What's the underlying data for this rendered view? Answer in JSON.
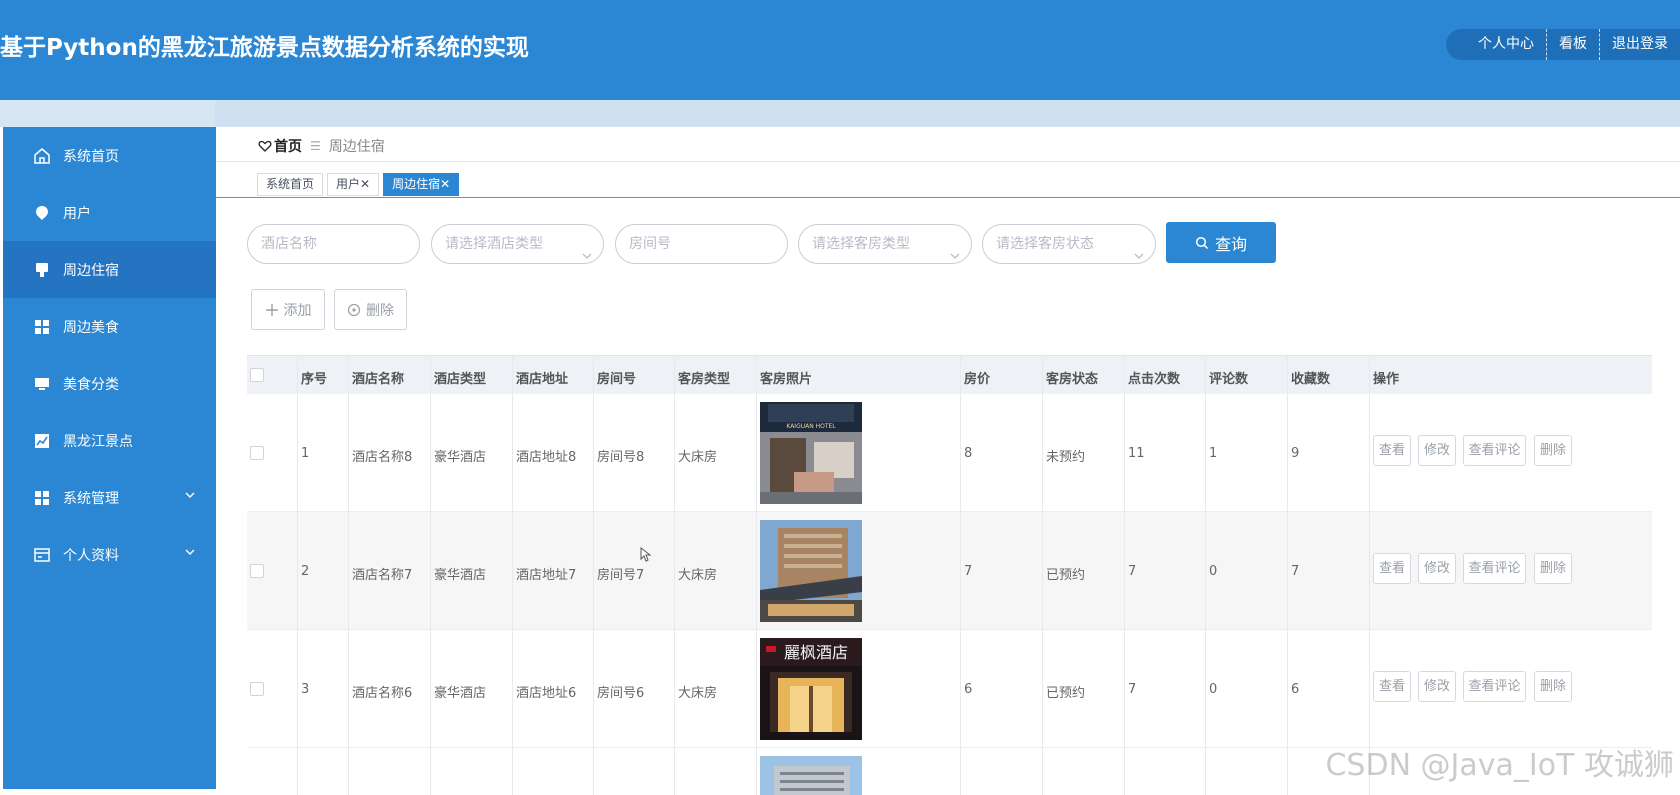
{
  "header": {
    "title": "基于Python的黑龙江旅游景点数据分析系统的实现",
    "actions": [
      "个人中心",
      "看板",
      "退出登录"
    ]
  },
  "sidebar": {
    "items": [
      {
        "label": "系统首页",
        "icon": "home-icon"
      },
      {
        "label": "用户",
        "icon": "user-icon"
      },
      {
        "label": "周边住宿",
        "icon": "hotel-icon",
        "active": true
      },
      {
        "label": "周边美食",
        "icon": "grid-icon"
      },
      {
        "label": "美食分类",
        "icon": "monitor-icon"
      },
      {
        "label": "黑龙江景点",
        "icon": "chart-icon"
      },
      {
        "label": "系统管理",
        "icon": "grid-icon",
        "expandable": true
      },
      {
        "label": "个人资料",
        "icon": "profile-icon",
        "expandable": true
      }
    ]
  },
  "breadcrumb": {
    "home": "首页",
    "current": "周边住宿"
  },
  "tabs": [
    {
      "label": "系统首页",
      "closable": false
    },
    {
      "label": "用户",
      "closable": true
    },
    {
      "label": "周边住宿",
      "closable": true,
      "active": true
    }
  ],
  "search": {
    "hotel_name_placeholder": "酒店名称",
    "hotel_type_placeholder": "请选择酒店类型",
    "room_no_placeholder": "房间号",
    "room_type_placeholder": "请选择客房类型",
    "room_status_placeholder": "请选择客房状态",
    "query_label": "查询"
  },
  "actions": {
    "add_label": "添加",
    "delete_label": "删除"
  },
  "table": {
    "headers": [
      "序号",
      "酒店名称",
      "酒店类型",
      "酒店地址",
      "房间号",
      "客房类型",
      "客房照片",
      "房价",
      "客房状态",
      "点击次数",
      "评论数",
      "收藏数",
      "操作"
    ],
    "rows": [
      {
        "index": "1",
        "name": "酒店名称8",
        "type": "豪华酒店",
        "address": "酒店地址8",
        "room_no": "房间号8",
        "room_type": "大床房",
        "price": "8",
        "status": "未预约",
        "clicks": "11",
        "comments": "1",
        "favorites": "9"
      },
      {
        "index": "2",
        "name": "酒店名称7",
        "type": "豪华酒店",
        "address": "酒店地址7",
        "room_no": "房间号7",
        "room_type": "大床房",
        "price": "7",
        "status": "已预约",
        "clicks": "7",
        "comments": "0",
        "favorites": "7"
      },
      {
        "index": "3",
        "name": "酒店名称6",
        "type": "豪华酒店",
        "address": "酒店地址6",
        "room_no": "房间号6",
        "room_type": "大床房",
        "price": "6",
        "status": "已预约",
        "clicks": "7",
        "comments": "0",
        "favorites": "6"
      }
    ],
    "row_actions": [
      "查看",
      "修改",
      "查看评论",
      "删除"
    ],
    "photo_signs": {
      "row1": "KAIGUAN HOTEL",
      "row3": "麗枫酒店"
    }
  },
  "watermark": "CSDN @Java_IoT 攻诚狮",
  "colors": {
    "primary": "#2b87d3",
    "sidebar_active": "#2574c2",
    "header_bg": "#2b87d3"
  }
}
